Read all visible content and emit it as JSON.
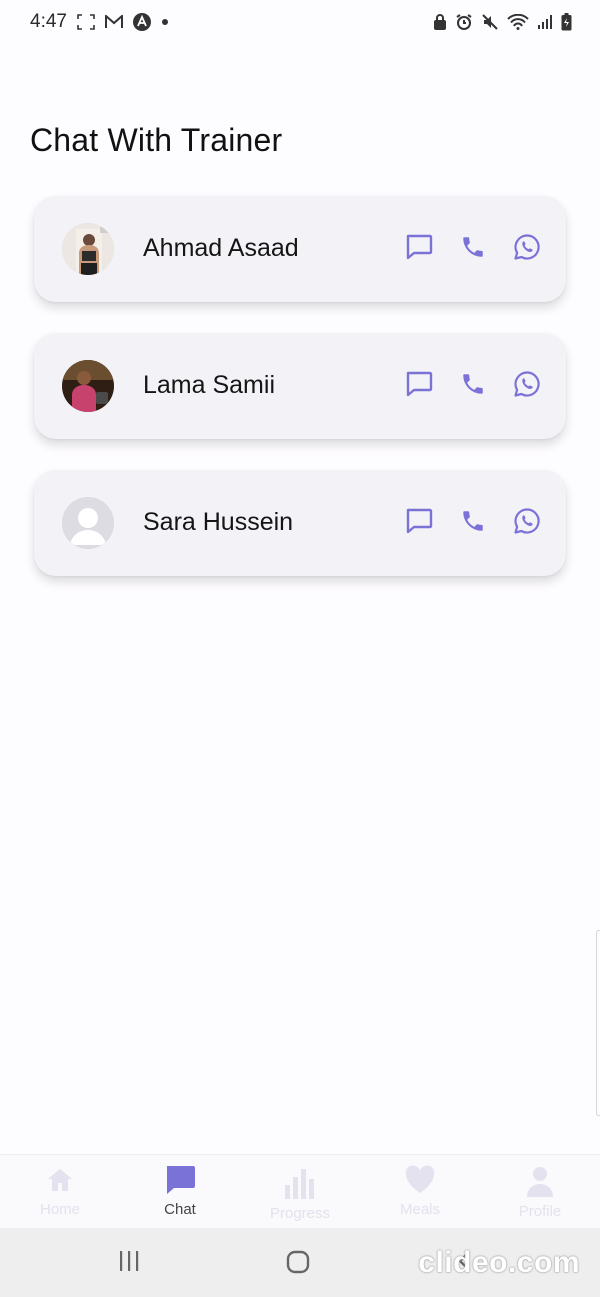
{
  "status_bar": {
    "time": "4:47",
    "left_icons": [
      "screen-record-icon",
      "gmail-icon",
      "app-a-icon",
      "notification-dot-icon"
    ],
    "right_icons": [
      "lock-icon",
      "alarm-icon",
      "mute-icon",
      "wifi-icon",
      "signal-icon",
      "battery-icon"
    ]
  },
  "page": {
    "title": "Chat With Trainer"
  },
  "trainers": [
    {
      "name": "Ahmad Asaad",
      "avatar": "photo-avatar-1",
      "actions": [
        "chat-icon",
        "phone-icon",
        "whatsapp-icon"
      ]
    },
    {
      "name": "Lama Samii",
      "avatar": "photo-avatar-2",
      "actions": [
        "chat-icon",
        "phone-icon",
        "whatsapp-icon"
      ]
    },
    {
      "name": "Sara Hussein",
      "avatar": "default-avatar",
      "actions": [
        "chat-icon",
        "phone-icon",
        "whatsapp-icon"
      ]
    }
  ],
  "bottom_nav": {
    "items": [
      {
        "label": "Home",
        "icon": "home-icon",
        "active": false
      },
      {
        "label": "Chat",
        "icon": "chat-bubble-icon",
        "active": true
      },
      {
        "label": "Progress",
        "icon": "bar-chart-icon",
        "active": false
      },
      {
        "label": "Meals",
        "icon": "heart-icon",
        "active": false
      },
      {
        "label": "Profile",
        "icon": "person-icon",
        "active": false
      }
    ]
  },
  "colors": {
    "accent": "#7b72d8",
    "inactive_nav": "#e3e2ee",
    "card_bg": "#f3f2f7"
  },
  "watermark": "clideo.com"
}
